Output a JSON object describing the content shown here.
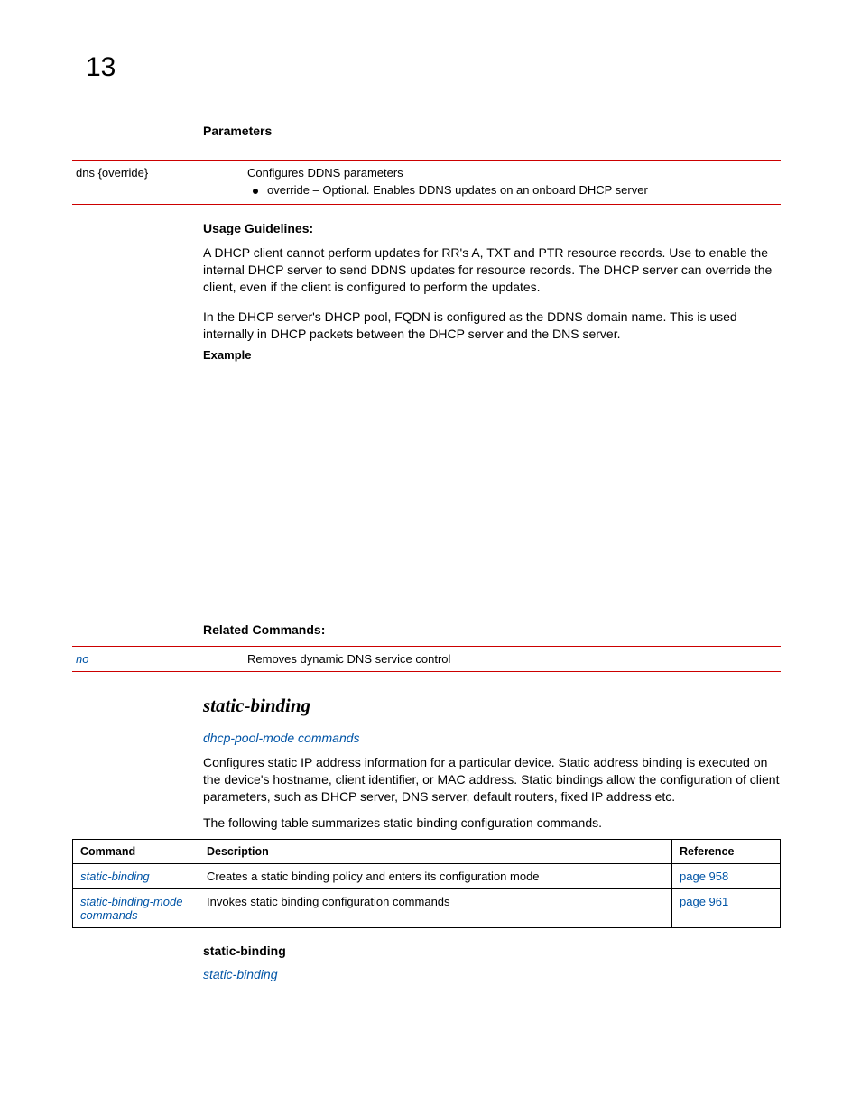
{
  "chapter": "13",
  "parameters_heading": "Parameters",
  "param_row": {
    "name": "dns {override}",
    "desc": "Configures DDNS parameters",
    "bullet": "override – Optional. Enables DDNS updates on an onboard DHCP server"
  },
  "usage_heading": "Usage Guidelines:",
  "usage_p1": "A DHCP client cannot perform updates for RR's A, TXT and PTR resource records. Use                                     to enable the internal DHCP server to send DDNS updates for resource records. The DHCP server can override the client, even if the client is configured to perform the updates.",
  "usage_p2": "In the DHCP server's DHCP pool, FQDN is configured as the DDNS domain name. This is used internally in DHCP packets between the DHCP server and the DNS server.",
  "example_heading": "Example",
  "related_heading": "Related Commands:",
  "related_row": {
    "cmd": "no",
    "desc": "Removes dynamic DNS service control"
  },
  "section_title": "static-binding",
  "subref": "dhcp-pool-mode commands",
  "sb_para1": "Configures static IP address information for a particular device. Static address binding is executed on the device's hostname, client identifier, or MAC address. Static bindings allow the configuration of client parameters, such as DHCP server, DNS server, default routers, fixed IP address etc.",
  "sb_para2": "The following table summarizes static binding configuration commands.",
  "cmd_table": {
    "headers": {
      "c1": "Command",
      "c2": "Description",
      "c3": "Reference"
    },
    "rows": [
      {
        "cmd": "static-binding",
        "desc": "Creates a static binding policy and enters its configuration mode",
        "ref": "page 958"
      },
      {
        "cmd": "static-binding-mode commands",
        "desc": "Invokes static binding configuration commands",
        "ref": "page 961"
      }
    ]
  },
  "sb_heading": "static-binding",
  "sb_ref": "static-binding"
}
